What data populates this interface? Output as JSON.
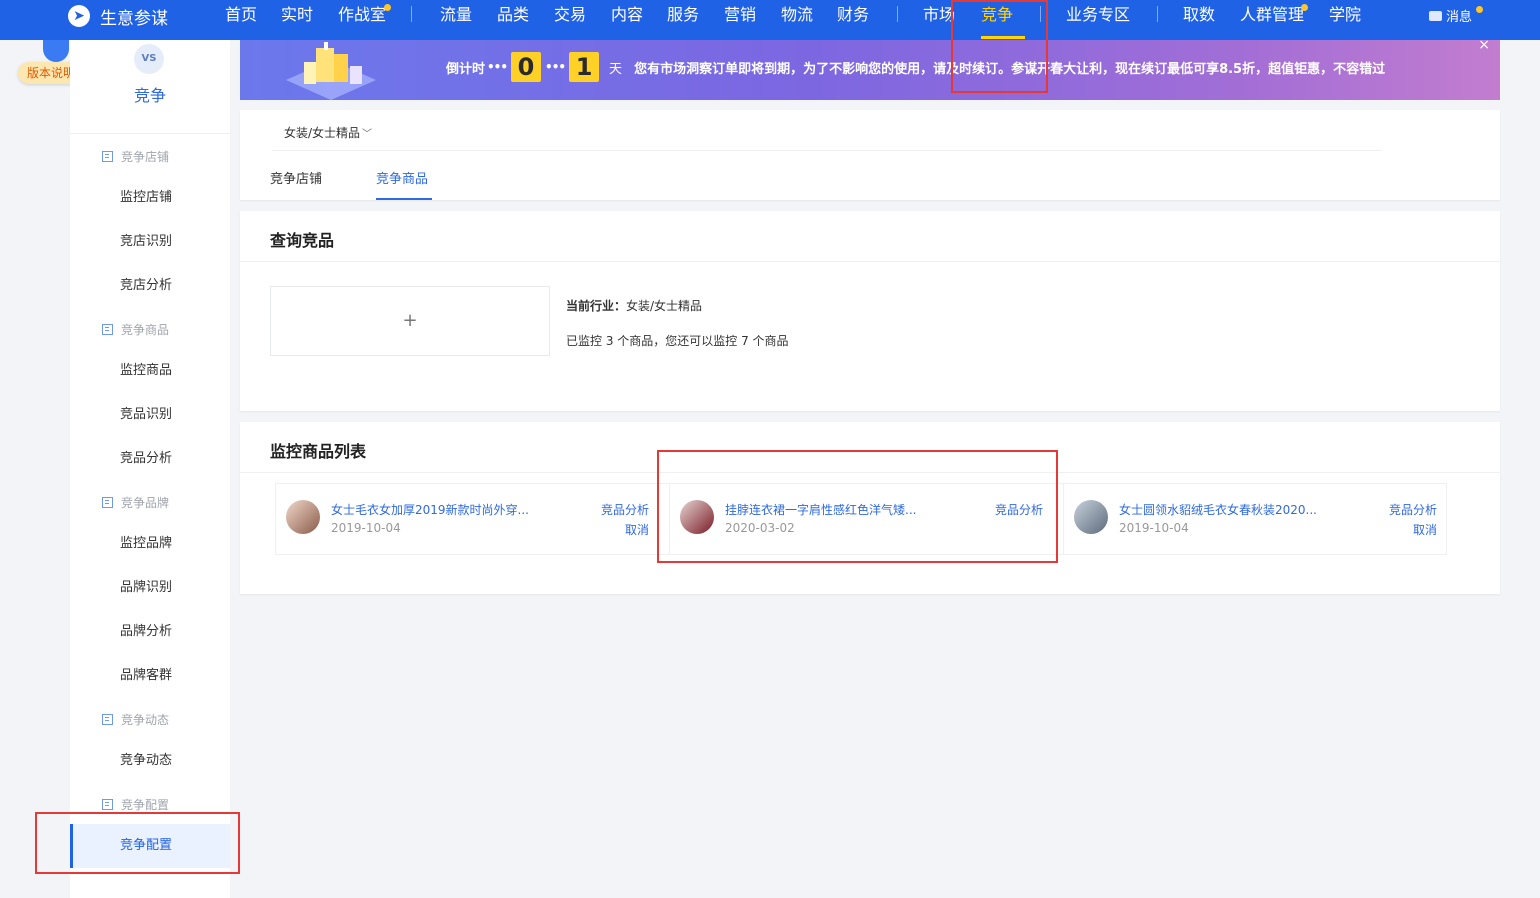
{
  "brand": {
    "name": "生意参谋",
    "logo_icon": "compass-icon"
  },
  "topnav": {
    "items": [
      {
        "label": "首页"
      },
      {
        "label": "实时"
      },
      {
        "label": "作战室"
      },
      {
        "label": "流量"
      },
      {
        "label": "品类"
      },
      {
        "label": "交易"
      },
      {
        "label": "内容"
      },
      {
        "label": "服务"
      },
      {
        "label": "营销"
      },
      {
        "label": "物流"
      },
      {
        "label": "财务"
      },
      {
        "label": "市场"
      },
      {
        "label": "竞争"
      },
      {
        "label": "业务专区"
      },
      {
        "label": "取数"
      },
      {
        "label": "人群管理"
      },
      {
        "label": "学院"
      }
    ],
    "active": "竞争",
    "messages": "消息"
  },
  "rail": {
    "version_badge": "版本说明"
  },
  "sidebar": {
    "title": "竞争",
    "groups": [
      {
        "label": "竞争店铺",
        "items": [
          "监控店铺",
          "竞店识别",
          "竞店分析"
        ]
      },
      {
        "label": "竞争商品",
        "items": [
          "监控商品",
          "竞品识别",
          "竞品分析"
        ]
      },
      {
        "label": "竞争品牌",
        "items": [
          "监控品牌",
          "品牌识别",
          "品牌分析",
          "品牌客群"
        ]
      },
      {
        "label": "竞争动态",
        "items": [
          "竞争动态"
        ]
      },
      {
        "label": "竞争配置",
        "items": [
          "竞争配置"
        ]
      }
    ],
    "active_item": "竞争配置"
  },
  "banner": {
    "countdown_label": "倒计时",
    "digits": [
      "0",
      "1"
    ],
    "unit": "天",
    "message": "您有市场洞察订单即将到期，为了不影响您的使用，请及时续订。参谋开春大让利，现在续订最低可享8.5折，超值钜惠，不容错过",
    "close": "×"
  },
  "tabs_card": {
    "industry": "女装/女士精品",
    "tabs": [
      {
        "label": "竞争店铺"
      },
      {
        "label": "竞争商品"
      }
    ],
    "active_tab": "竞争商品"
  },
  "query_card": {
    "title": "查询竞品",
    "add_symbol": "+",
    "industry_label": "当前行业：",
    "industry_value": "女装/女士精品",
    "monitor_text": "已监控 3 个商品，您还可以监控 7 个商品"
  },
  "list_card": {
    "title": "监控商品列表",
    "analyze_label": "竞品分析",
    "cancel_label": "取消",
    "products": [
      {
        "title": "女士毛衣女加厚2019新款时尚外穿...",
        "date": "2019-10-04",
        "thumb_color": "#8a5a48"
      },
      {
        "title": "挂脖连衣裙一字肩性感红色洋气矮...",
        "date": "2020-03-02",
        "thumb_color": "#7a1a26"
      },
      {
        "title": "女士圆领水貂绒毛衣女春秋装2020...",
        "date": "2019-10-04",
        "thumb_color": "#5c6a7c"
      }
    ]
  },
  "colors": {
    "nav_blue": "#2062e6",
    "accent": "#2f6ae0",
    "active_nav": "#ffd400",
    "highlight_red": "#e53935"
  }
}
